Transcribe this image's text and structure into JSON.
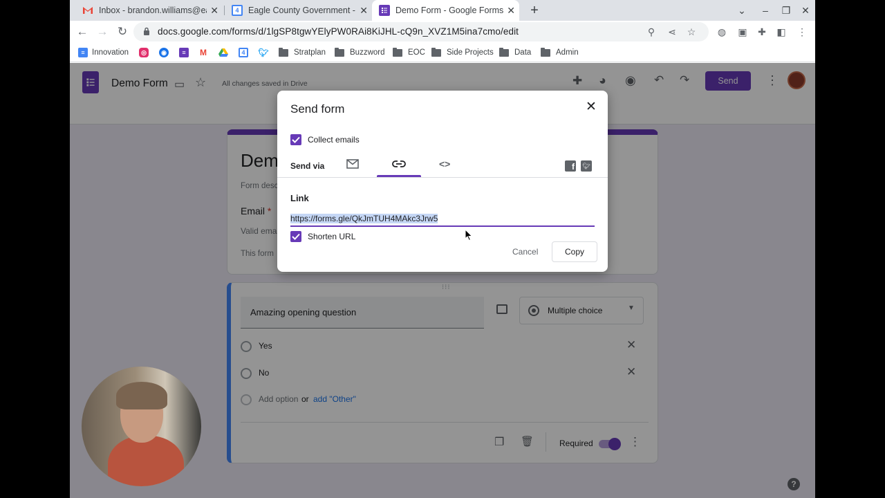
{
  "browser": {
    "tabs": [
      {
        "title": "Inbox - brandon.williams@eagle"
      },
      {
        "title": "Eagle County Government - Cale"
      },
      {
        "title": "Demo Form - Google Forms"
      }
    ],
    "url": "docs.google.com/forms/d/1lgSP8tgwYElyPW0RAi8KiJHL-cQ9n_XVZ1M5ina7cmo/edit",
    "bookmarks": [
      "Innovation",
      "Stratplan",
      "Buzzword",
      "EOC",
      "Side Projects",
      "Data",
      "Admin"
    ]
  },
  "form_header": {
    "title": "Demo Form",
    "save_status": "All changes saved in Drive",
    "send_label": "Send"
  },
  "form_body": {
    "title_partial": "Dem",
    "description_partial": "Form desc",
    "email_label": "Email",
    "required_star": "*",
    "email_placeholder_partial": "Valid ema",
    "collect_note_partial": "This form"
  },
  "question": {
    "title": "Amazing opening question",
    "type": "Multiple choice",
    "options": [
      "Yes",
      "No"
    ],
    "add_option": "Add option",
    "or": "or",
    "add_other": "add \"Other\"",
    "required_label": "Required"
  },
  "dialog": {
    "title": "Send form",
    "collect_emails": "Collect emails",
    "send_via": "Send via",
    "link_heading": "Link",
    "link_url": "https://forms.gle/QkJmTUH4MAkc3Jrw5",
    "shorten_url": "Shorten URL",
    "cancel_label": "Cancel",
    "copy_label": "Copy"
  },
  "colors": {
    "accent": "#673ab7",
    "question_accent": "#4285f4",
    "link_blue": "#1a73e8"
  }
}
